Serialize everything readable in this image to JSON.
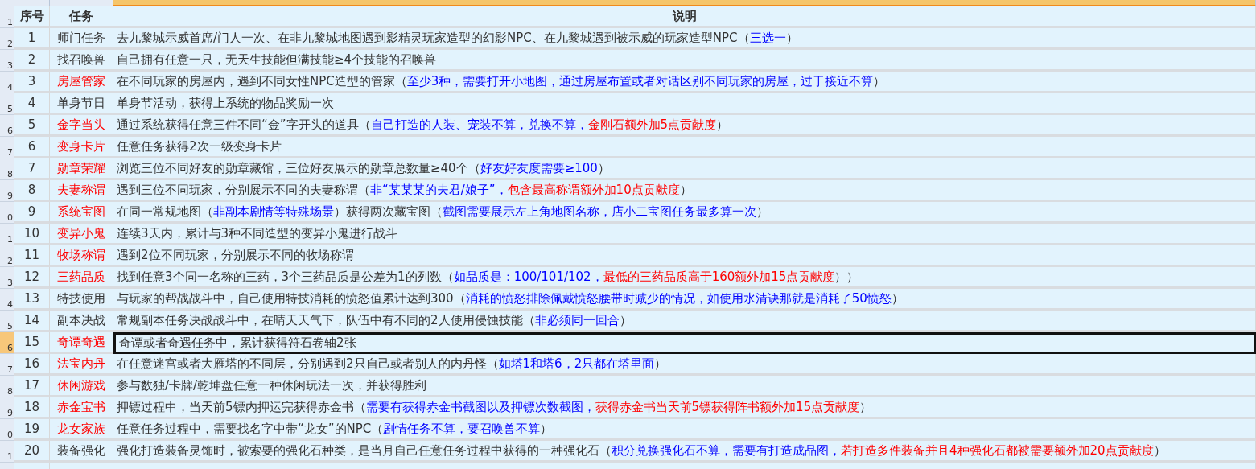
{
  "column_headers": [
    {
      "selected": false
    },
    {
      "selected": false
    },
    {
      "selected": true
    }
  ],
  "header": {
    "row_label": "1",
    "columns": [
      "序号",
      "任务",
      "说明"
    ]
  },
  "rows": [
    {
      "row_label": "2",
      "no": "1",
      "task": {
        "text": "师门任务",
        "color": "#333333"
      },
      "selected": false,
      "parts": [
        {
          "text": "去九黎城示威首席/门人一次、在非九黎城地图遇到影精灵玩家造型的幻影NPC、在九黎城遇到被示威的玩家造型NPC（",
          "color": "#333333"
        },
        {
          "text": "三选一",
          "color": "#0000ff"
        },
        {
          "text": "）",
          "color": "#333333"
        }
      ]
    },
    {
      "row_label": "3",
      "no": "2",
      "task": {
        "text": "找召唤兽",
        "color": "#333333"
      },
      "selected": false,
      "parts": [
        {
          "text": "自己拥有任意一只，无天生技能但满技能≥4个技能的召唤兽",
          "color": "#333333"
        }
      ]
    },
    {
      "row_label": "4",
      "no": "3",
      "task": {
        "text": "房屋管家",
        "color": "#ff0000"
      },
      "selected": false,
      "parts": [
        {
          "text": "在不同玩家的房屋内，遇到不同女性NPC造型的管家（",
          "color": "#333333"
        },
        {
          "text": "至少3种，需要打开小地图，通过房屋布置或者对话区别不同玩家的房屋，过于接近不算",
          "color": "#0000ff"
        },
        {
          "text": "）",
          "color": "#333333"
        }
      ]
    },
    {
      "row_label": "5",
      "no": "4",
      "task": {
        "text": "单身节日",
        "color": "#333333"
      },
      "selected": false,
      "parts": [
        {
          "text": "单身节活动，获得上系统的物品奖励一次",
          "color": "#333333"
        }
      ]
    },
    {
      "row_label": "6",
      "no": "5",
      "task": {
        "text": "金字当头",
        "color": "#ff0000"
      },
      "selected": false,
      "parts": [
        {
          "text": "通过系统获得任意三件不同“金”字开头的道具（",
          "color": "#333333"
        },
        {
          "text": "自己打造的人装、宠装不算，兑换不算，",
          "color": "#0000ff"
        },
        {
          "text": "金刚石额外加5点贡献度",
          "color": "#ff0000"
        },
        {
          "text": "）",
          "color": "#333333"
        }
      ]
    },
    {
      "row_label": "7",
      "no": "6",
      "task": {
        "text": "变身卡片",
        "color": "#ff0000"
      },
      "selected": false,
      "parts": [
        {
          "text": "任意任务获得2次一级变身卡片",
          "color": "#333333"
        }
      ]
    },
    {
      "row_label": "8",
      "no": "7",
      "task": {
        "text": "勋章荣耀",
        "color": "#ff0000"
      },
      "selected": false,
      "parts": [
        {
          "text": "浏览三位不同好友的勋章藏馆，三位好友展示的勋章总数量≥40个（",
          "color": "#333333"
        },
        {
          "text": "好友好友度需要≥100",
          "color": "#0000ff"
        },
        {
          "text": "）",
          "color": "#333333"
        }
      ]
    },
    {
      "row_label": "9",
      "no": "8",
      "task": {
        "text": "夫妻称谓",
        "color": "#ff0000"
      },
      "selected": false,
      "parts": [
        {
          "text": "遇到三位不同玩家，分别展示不同的夫妻称谓（",
          "color": "#333333"
        },
        {
          "text": "非“某某某的夫君/娘子”，",
          "color": "#0000ff"
        },
        {
          "text": "包含最高称谓额外加10点贡献度",
          "color": "#ff0000"
        },
        {
          "text": "）",
          "color": "#333333"
        }
      ]
    },
    {
      "row_label": "0",
      "no": "9",
      "task": {
        "text": "系统宝图",
        "color": "#ff0000"
      },
      "selected": false,
      "parts": [
        {
          "text": "在同一常规地图（",
          "color": "#333333"
        },
        {
          "text": "非副本剧情等特殊场景",
          "color": "#0000ff"
        },
        {
          "text": "）获得两次藏宝图（",
          "color": "#333333"
        },
        {
          "text": "截图需要展示左上角地图名称，店小二宝图任务最多算一次",
          "color": "#0000ff"
        },
        {
          "text": "）",
          "color": "#333333"
        }
      ]
    },
    {
      "row_label": "1",
      "no": "10",
      "task": {
        "text": "变异小鬼",
        "color": "#ff0000"
      },
      "selected": false,
      "parts": [
        {
          "text": "连续3天内，累计与3种不同造型的变异小鬼进行战斗",
          "color": "#333333"
        }
      ]
    },
    {
      "row_label": "2",
      "no": "11",
      "task": {
        "text": "牧场称谓",
        "color": "#ff0000"
      },
      "selected": false,
      "parts": [
        {
          "text": "遇到2位不同玩家，分别展示不同的牧场称谓",
          "color": "#333333"
        }
      ]
    },
    {
      "row_label": "3",
      "no": "12",
      "task": {
        "text": "三药品质",
        "color": "#ff0000"
      },
      "selected": false,
      "parts": [
        {
          "text": "找到任意3个同一名称的三药，3个三药品质是公差为1的列数（",
          "color": "#333333"
        },
        {
          "text": "如品质是：100/101/102，",
          "color": "#0000ff"
        },
        {
          "text": "最低的三药品质高于160额外加15点贡献度",
          "color": "#ff0000"
        },
        {
          "text": "））",
          "color": "#333333"
        }
      ]
    },
    {
      "row_label": "4",
      "no": "13",
      "task": {
        "text": "特技使用",
        "color": "#333333"
      },
      "selected": false,
      "parts": [
        {
          "text": "与玩家的帮战战斗中，自己使用特技消耗的愤怒值累计达到300（",
          "color": "#333333"
        },
        {
          "text": "消耗的愤怒排除佩戴愤怒腰带时减少的情况，如使用水清诀那就是消耗了50愤怒",
          "color": "#0000ff"
        },
        {
          "text": "）",
          "color": "#333333"
        }
      ]
    },
    {
      "row_label": "5",
      "no": "14",
      "task": {
        "text": "副本决战",
        "color": "#333333"
      },
      "selected": false,
      "parts": [
        {
          "text": "常规副本任务决战战斗中，在晴天天气下，队伍中有不同的2人使用侵蚀技能（",
          "color": "#333333"
        },
        {
          "text": "非必须同一回合",
          "color": "#0000ff"
        },
        {
          "text": "）",
          "color": "#333333"
        }
      ]
    },
    {
      "row_label": "6",
      "no": "15",
      "task": {
        "text": "奇谭奇遇",
        "color": "#ff0000"
      },
      "selected": true,
      "parts": [
        {
          "text": "奇谭或者奇遇任务中，累计获得符石卷轴2张",
          "color": "#333333"
        }
      ]
    },
    {
      "row_label": "7",
      "no": "16",
      "task": {
        "text": "法宝内丹",
        "color": "#ff0000"
      },
      "selected": false,
      "parts": [
        {
          "text": "在任意迷宫或者大雁塔的不同层，分别遇到2只自己或者别人的内丹怪（",
          "color": "#333333"
        },
        {
          "text": "如塔1和塔6，2只都在塔里面",
          "color": "#0000ff"
        },
        {
          "text": "）",
          "color": "#333333"
        }
      ]
    },
    {
      "row_label": "8",
      "no": "17",
      "task": {
        "text": "休闲游戏",
        "color": "#ff0000"
      },
      "selected": false,
      "parts": [
        {
          "text": "参与数独/卡牌/乾坤盘任意一种休闲玩法一次，并获得胜利",
          "color": "#333333"
        }
      ]
    },
    {
      "row_label": "9",
      "no": "18",
      "task": {
        "text": "赤金宝书",
        "color": "#ff0000"
      },
      "selected": false,
      "parts": [
        {
          "text": "押镖过程中，当天前5镖内押运完获得赤金书（",
          "color": "#333333"
        },
        {
          "text": "需要有获得赤金书截图以及押镖次数截图，",
          "color": "#0000ff"
        },
        {
          "text": "获得赤金书当天前5镖获得阵书额外加15点贡献度",
          "color": "#ff0000"
        },
        {
          "text": "）",
          "color": "#333333"
        }
      ]
    },
    {
      "row_label": "0",
      "no": "19",
      "task": {
        "text": "龙女家族",
        "color": "#ff0000"
      },
      "selected": false,
      "parts": [
        {
          "text": "任意任务过程中，需要找名字中带“龙女”的NPC（",
          "color": "#333333"
        },
        {
          "text": "剧情任务不算，要召唤兽不算",
          "color": "#0000ff"
        },
        {
          "text": "）",
          "color": "#333333"
        }
      ]
    },
    {
      "row_label": "1",
      "no": "20",
      "task": {
        "text": "装备强化",
        "color": "#333333"
      },
      "selected": false,
      "parts": [
        {
          "text": "强化打造装备灵饰时，被索要的强化石种类，是当月自己任意任务过程中获得的一种强化石（",
          "color": "#333333"
        },
        {
          "text": "积分兑换强化石不算，需要有打造成品图，",
          "color": "#0000ff"
        },
        {
          "text": "若打造多件装备并且4种强化石都被需要额外加20点贡献度",
          "color": "#ff0000"
        },
        {
          "text": "）",
          "color": "#333333"
        }
      ]
    }
  ]
}
